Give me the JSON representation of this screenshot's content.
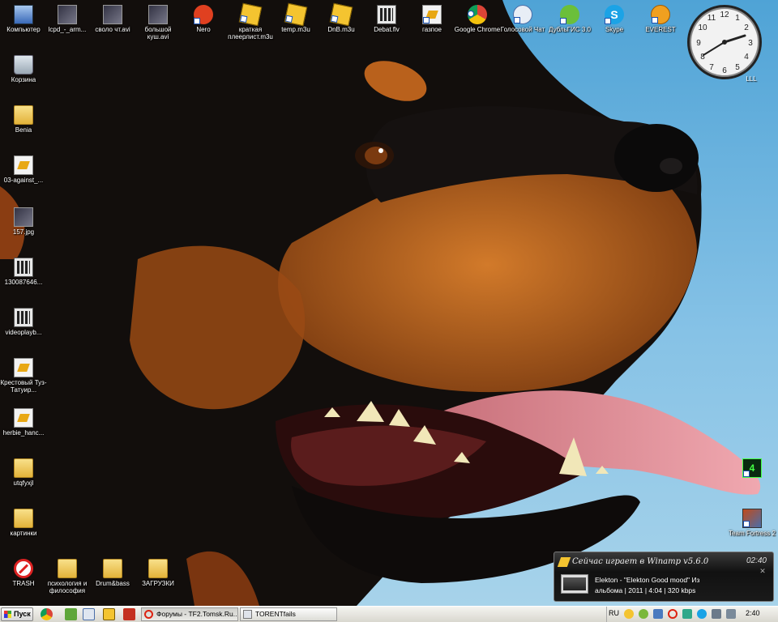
{
  "desktop": {
    "top_icons": [
      {
        "label": "Компьютер",
        "icon": "computer-icon"
      },
      {
        "label": "lcpd_-_arm...",
        "icon": "image-icon"
      },
      {
        "label": "своло чт.avi",
        "icon": "video-icon"
      },
      {
        "label": "большой куш.avi",
        "icon": "video-icon"
      },
      {
        "label": "Nero",
        "icon": "nero-icon"
      },
      {
        "label": "краткая плеерлист.m3u",
        "icon": "winamp-playlist-icon"
      },
      {
        "label": "temp.m3u",
        "icon": "winamp-playlist-icon"
      },
      {
        "label": "DnB.m3u",
        "icon": "winamp-playlist-icon"
      },
      {
        "label": "Debat.flv",
        "icon": "video-file-icon"
      },
      {
        "label": "газпое",
        "icon": "document-shortcut-icon"
      },
      {
        "label": "Google Chrome",
        "icon": "chrome-icon"
      },
      {
        "label": "Голосовой Чат",
        "icon": "voice-chat-icon"
      },
      {
        "label": "ДубльГИС 3.0",
        "icon": "2gis-icon"
      },
      {
        "label": "Skype",
        "icon": "skype-icon"
      },
      {
        "label": "EVEREST",
        "icon": "everest-icon"
      }
    ],
    "left_icons": [
      {
        "label": "Корзина",
        "icon": "recycle-bin-icon"
      },
      {
        "label": "Benia",
        "icon": "folder-icon"
      },
      {
        "label": "03-against_...",
        "icon": "audio-file-icon"
      },
      {
        "label": "157.jpg",
        "icon": "image-file-icon"
      },
      {
        "label": "130087646...",
        "icon": "video-file-icon"
      },
      {
        "label": "videoplayb...",
        "icon": "video-file-icon"
      },
      {
        "label": "Крестовый Туз-Татуир...",
        "icon": "audio-file-icon"
      },
      {
        "label": "herbie_hanc...",
        "icon": "audio-file-icon"
      },
      {
        "label": "utqfyxjl",
        "icon": "folder-icon"
      },
      {
        "label": "картинки",
        "icon": "folder-icon"
      }
    ],
    "bottom_icons": [
      {
        "label": "TRASH",
        "icon": "trash-icon"
      },
      {
        "label": "психология и философия",
        "icon": "folder-icon"
      },
      {
        "label": "Drum&bass",
        "icon": "folder-icon"
      },
      {
        "label": "ЗАГРУЗКИ",
        "icon": "folder-icon"
      }
    ],
    "right_icons": [
      {
        "label": "",
        "icon": "left4dead-icon"
      },
      {
        "label": "Team Fortress 2",
        "icon": "team-fortress-icon"
      }
    ],
    "clock_gadget_label": "LLL",
    "wallpaper": "rottweiler-wallpaper"
  },
  "now_playing": {
    "title": "Сейчас играет в Winamp v5.6.0",
    "time": "02:40",
    "track_line1": "Elekton - \"Elekton Good mood\"  Из",
    "track_line2": "альбома  | 2011 | 4:04 | 320 kbps"
  },
  "taskbar": {
    "start_label": "Пуск",
    "tasks": [
      {
        "label": "Форумы - TF2.Tomsk.Ru...",
        "icon": "opera-icon",
        "active": true
      },
      {
        "label": "TORENTfails",
        "icon": "folder-window-icon",
        "active": false
      }
    ],
    "language": "RU",
    "clock": "2:40"
  },
  "colors": {
    "taskbar_bg": "#e4e2da",
    "sky": "#86c2e6",
    "popup_bg": "#1a1a1a"
  }
}
